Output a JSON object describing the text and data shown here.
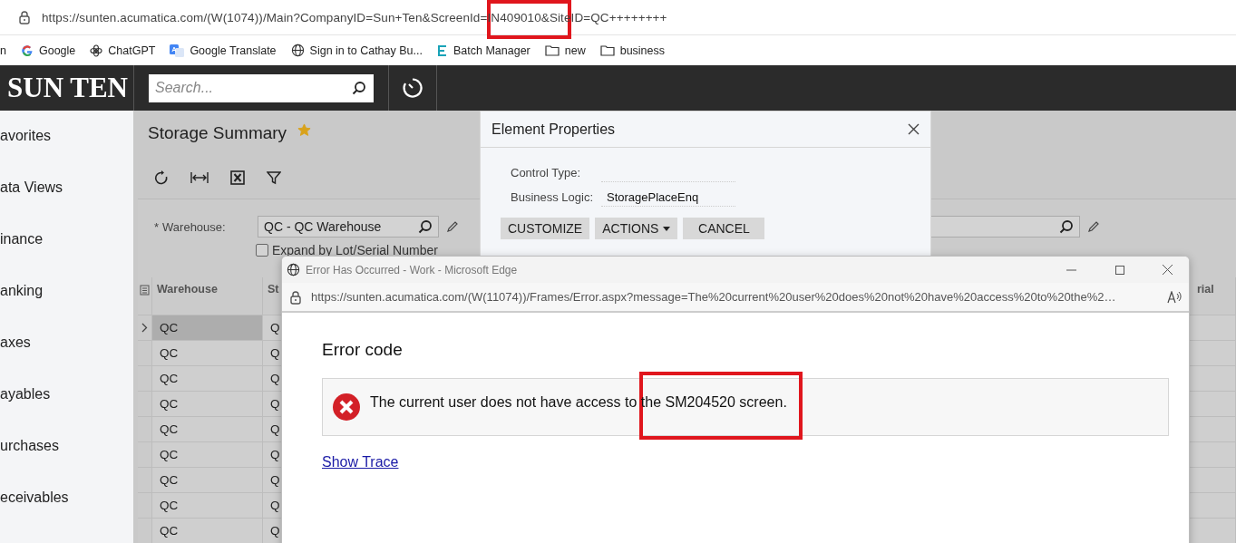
{
  "browser": {
    "url": "https://sunten.acumatica.com/(W(1074))/Main?CompanyID=Sun+Ten&ScreenId=IN409010&SiteID=QC++++++++",
    "bookmarks": [
      {
        "label": "n",
        "kind": "text"
      },
      {
        "label": "Google",
        "kind": "google"
      },
      {
        "label": "ChatGPT",
        "kind": "chatgpt"
      },
      {
        "label": "Google Translate",
        "kind": "translate"
      },
      {
        "label": "Sign in to Cathay Bu...",
        "kind": "globe"
      },
      {
        "label": "Batch Manager",
        "kind": "batch"
      },
      {
        "label": "new",
        "kind": "folder"
      },
      {
        "label": "business",
        "kind": "folder"
      }
    ]
  },
  "header": {
    "logo": "SUN TEN",
    "search": {
      "placeholder": "Search..."
    }
  },
  "sidebar": {
    "items": [
      {
        "label": "avorites"
      },
      {
        "label": "ata Views"
      },
      {
        "label": "inance"
      },
      {
        "label": "anking"
      },
      {
        "label": "axes"
      },
      {
        "label": "ayables"
      },
      {
        "label": "urchases"
      },
      {
        "label": "eceivables"
      }
    ]
  },
  "page": {
    "title": "Storage Summary",
    "favorite": true,
    "filters": {
      "required_mark": "*",
      "warehouse_label": "Warehouse:",
      "warehouse_value": "QC - QC Warehouse",
      "expand_label": "Expand by Lot/Serial Number",
      "expand_checked": false
    },
    "grid": {
      "columns": [
        "Warehouse",
        "St",
        "rial"
      ],
      "rows": [
        {
          "cells": [
            "QC",
            "Q"
          ],
          "selected": true
        },
        {
          "cells": [
            "QC",
            "Q"
          ],
          "selected": false
        },
        {
          "cells": [
            "QC",
            "Q"
          ],
          "selected": false
        },
        {
          "cells": [
            "QC",
            "Q"
          ],
          "selected": false
        },
        {
          "cells": [
            "QC",
            "Q"
          ],
          "selected": false
        },
        {
          "cells": [
            "QC",
            "Q"
          ],
          "selected": false
        },
        {
          "cells": [
            "QC",
            "Q"
          ],
          "selected": false
        },
        {
          "cells": [
            "QC",
            "Q"
          ],
          "selected": false
        },
        {
          "cells": [
            "QC",
            "Q"
          ],
          "selected": false
        }
      ]
    }
  },
  "element_properties": {
    "title": "Element Properties",
    "fields": [
      {
        "label": "Control Type:"
      },
      {
        "label": "Business Logic:",
        "value": "StoragePlaceEnq"
      }
    ],
    "buttons": [
      {
        "label": "CUSTOMIZE",
        "kind": "plain"
      },
      {
        "label": "ACTIONS",
        "kind": "dropdown"
      },
      {
        "label": "CANCEL",
        "kind": "plain"
      }
    ]
  },
  "error_window": {
    "title": "Error Has Occurred - Work - Microsoft Edge",
    "url": "https://sunten.acumatica.com/(W(11074))/Frames/Error.aspx?message=The%20current%20user%20does%20not%20have%20access%20to%20the%2…",
    "heading": "Error code",
    "message": "The current user does not have access to the SM204520 screen.",
    "link": "Show Trace"
  }
}
